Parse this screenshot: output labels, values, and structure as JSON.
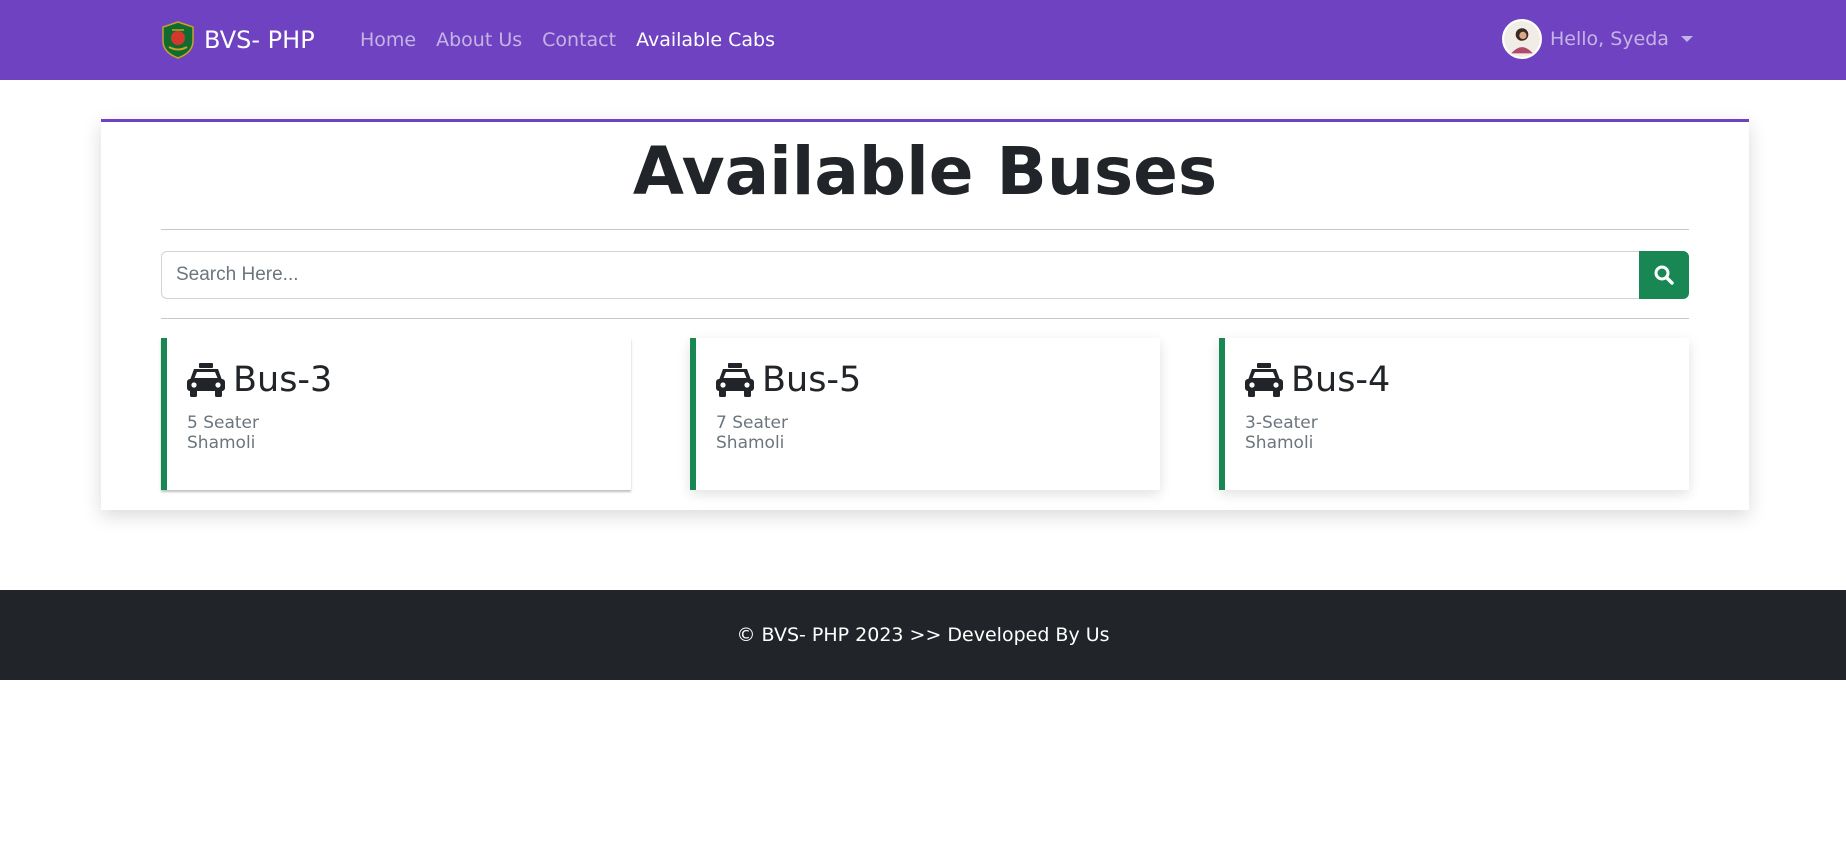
{
  "navbar": {
    "brand": "BVS- PHP",
    "links": [
      {
        "label": "Home"
      },
      {
        "label": "About Us"
      },
      {
        "label": "Contact"
      },
      {
        "label": "Available Cabs",
        "active": true
      }
    ],
    "user_greeting": "Hello, Syeda",
    "brand_color": "#6f42c1"
  },
  "main": {
    "title": "Available Buses",
    "search": {
      "placeholder": "Search Here...",
      "value": "",
      "button_icon": "search-icon"
    },
    "buses": [
      {
        "name": "Bus-3",
        "seats": "5 Seater",
        "location": "Shamoli",
        "icon": "taxi-icon"
      },
      {
        "name": "Bus-5",
        "seats": "7 Seater",
        "location": "Shamoli",
        "icon": "taxi-icon"
      },
      {
        "name": "Bus-4",
        "seats": "3-Seater",
        "location": "Shamoli",
        "icon": "taxi-icon"
      }
    ],
    "accent_color": "#198754"
  },
  "footer": {
    "text": "© BVS- PHP 2023 >> Developed By Us"
  }
}
